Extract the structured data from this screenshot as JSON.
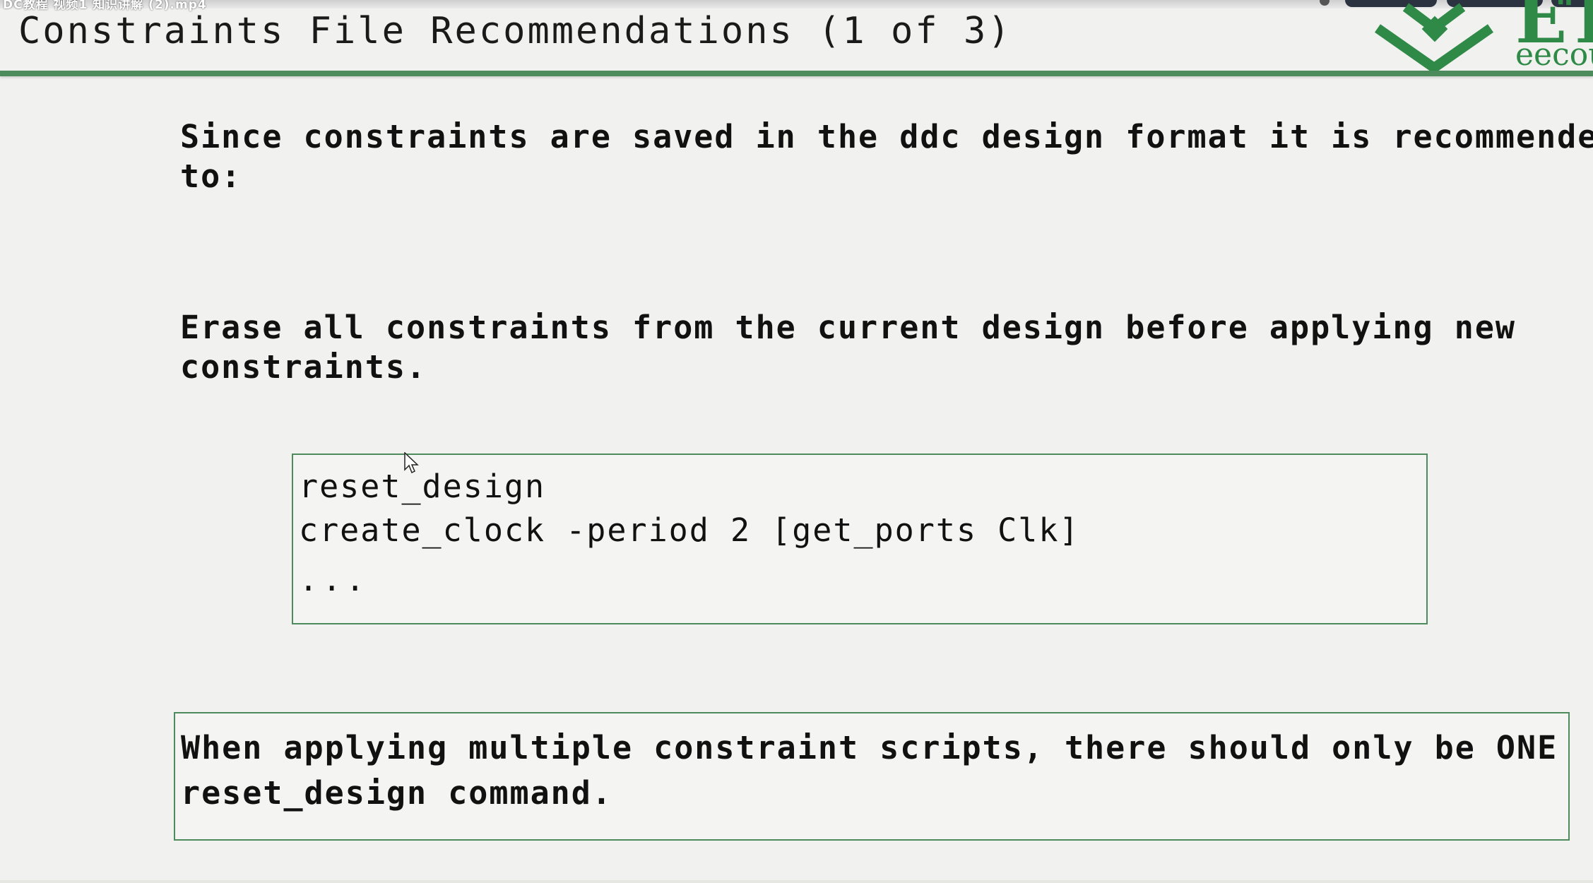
{
  "video": {
    "top_strip_text": "DC教程 视频1 知识讲解 (2).mp4"
  },
  "slide": {
    "title": "Constraints File Recommendations (1 of 3)",
    "intro": {
      "line1": "Since constraints are saved in the ddc design format it is recommended",
      "line2": "to:"
    },
    "recommendation": {
      "line1": "Erase all constraints from the current design before applying new",
      "line2": "constraints."
    },
    "code": {
      "lines": [
        "reset_design",
        "create_clock -period 2 [get_ports Clk]",
        "..."
      ]
    },
    "note": {
      "line1": "When applying multiple constraint scripts, there should only be ONE",
      "line2": "reset_design command."
    },
    "logo": {
      "mark": "ET",
      "sub": "eecou"
    }
  },
  "colors": {
    "accent_green": "#4d8b5d",
    "logo_green": "#2f8a48",
    "background": "#f1f1ef",
    "text": "#111111"
  },
  "icons": {
    "cursor": "mouse-pointer-icon",
    "logo": "eecourse-logo-icon"
  }
}
